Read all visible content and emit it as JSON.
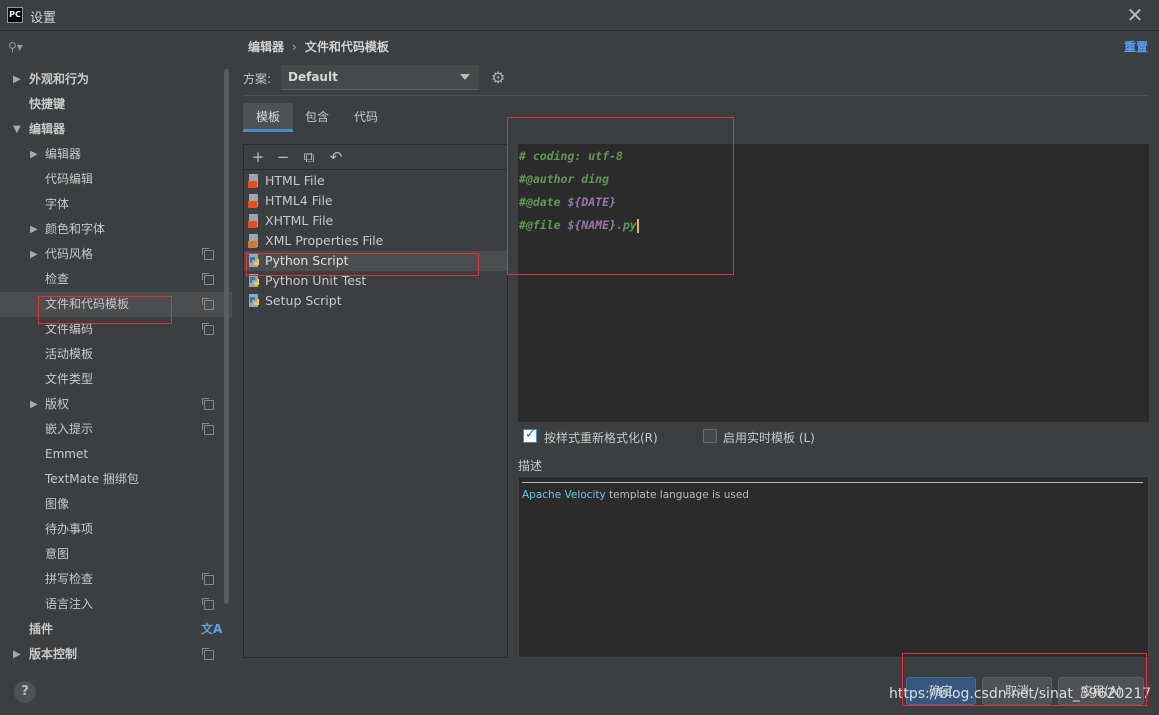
{
  "window": {
    "logo": "PC",
    "title": "设置"
  },
  "sidebar": {
    "search_placeholder": "",
    "items": [
      {
        "label": "外观和行为",
        "level": 0,
        "arrow": "▶"
      },
      {
        "label": "快捷键",
        "level": 0,
        "arrow": ""
      },
      {
        "label": "编辑器",
        "level": 0,
        "arrow": "▼"
      },
      {
        "label": "编辑器",
        "level": 1,
        "arrow": "▶"
      },
      {
        "label": "代码编辑",
        "level": 1,
        "arrow": ""
      },
      {
        "label": "字体",
        "level": 1,
        "arrow": ""
      },
      {
        "label": "颜色和字体",
        "level": 1,
        "arrow": "▶"
      },
      {
        "label": "代码风格",
        "level": 1,
        "arrow": "▶",
        "copy": true
      },
      {
        "label": "检查",
        "level": 1,
        "arrow": "",
        "copy": true
      },
      {
        "label": "文件和代码模板",
        "level": 1,
        "arrow": "",
        "copy": true,
        "selected": true
      },
      {
        "label": "文件编码",
        "level": 1,
        "arrow": "",
        "copy": true
      },
      {
        "label": "活动模板",
        "level": 1,
        "arrow": ""
      },
      {
        "label": "文件类型",
        "level": 1,
        "arrow": ""
      },
      {
        "label": "版权",
        "level": 1,
        "arrow": "▶",
        "copy": true
      },
      {
        "label": "嵌入提示",
        "level": 1,
        "arrow": "",
        "copy": true
      },
      {
        "label": "Emmet",
        "level": 1,
        "arrow": ""
      },
      {
        "label": "TextMate 捆绑包",
        "level": 1,
        "arrow": ""
      },
      {
        "label": "图像",
        "level": 1,
        "arrow": ""
      },
      {
        "label": "待办事项",
        "level": 1,
        "arrow": ""
      },
      {
        "label": "意图",
        "level": 1,
        "arrow": ""
      },
      {
        "label": "拼写检查",
        "level": 1,
        "arrow": "",
        "copy": true
      },
      {
        "label": "语言注入",
        "level": 1,
        "arrow": "",
        "copy": true
      },
      {
        "label": "插件",
        "level": 0,
        "arrow": "",
        "translate": true
      },
      {
        "label": "版本控制",
        "level": 0,
        "arrow": "▶",
        "copy": true
      }
    ],
    "translate_glyph": "文A"
  },
  "breadcrumb": {
    "parent": "编辑器",
    "separator": "›",
    "current": "文件和代码模板"
  },
  "reset_label": "重置",
  "scheme": {
    "label": "方案:",
    "value": "Default"
  },
  "tabs": [
    {
      "label": "模板",
      "active": true
    },
    {
      "label": "包含",
      "active": false
    },
    {
      "label": "代码",
      "active": false
    }
  ],
  "toolbar": {
    "add": "+",
    "remove": "−",
    "copy": "⧉",
    "revert": "↶"
  },
  "templates": [
    {
      "name": "HTML File",
      "icon": "html-file-icon",
      "color": "#e44d26"
    },
    {
      "name": "HTML4 File",
      "icon": "html-file-icon",
      "color": "#e44d26"
    },
    {
      "name": "XHTML File",
      "icon": "html-file-icon",
      "color": "#e44d26"
    },
    {
      "name": "XML Properties File",
      "icon": "xml-file-icon",
      "color": "#c77a3a"
    },
    {
      "name": "Python Script",
      "icon": "python-file-icon",
      "color": "#3b77a8",
      "selected": true
    },
    {
      "name": "Python Unit Test",
      "icon": "python-file-icon",
      "color": "#3b77a8"
    },
    {
      "name": "Setup Script",
      "icon": "python-file-icon",
      "color": "#3b77a8"
    }
  ],
  "code": {
    "line1": "# coding: utf-8",
    "line2": "#@author ding",
    "line3_prefix": "#@date ",
    "line3_var": "${DATE}",
    "line4_prefix": "#@file ",
    "line4_var": "${NAME}",
    "line4_suffix": ".py"
  },
  "options": {
    "reformat_label": "按样式重新格式化(R)",
    "reformat_checked": true,
    "live_template_label": "启用实时模板 (L)",
    "live_template_checked": false
  },
  "description": {
    "label": "描述",
    "link_text": "Apache Velocity",
    "text": " template language is used"
  },
  "buttons": {
    "help": "?",
    "ok": "确定",
    "cancel": "取消",
    "apply": "应用(A)"
  },
  "watermark": "https://blog.csdn.net/sinat_39620217",
  "colors": {
    "background": "#3c3f41",
    "editor_background": "#2b2b2b",
    "comment_green": "#629755",
    "template_var": "#9876aa",
    "link_blue": "#589df6",
    "selection": "#4b4d4f",
    "highlight_red": "#e0303a"
  }
}
